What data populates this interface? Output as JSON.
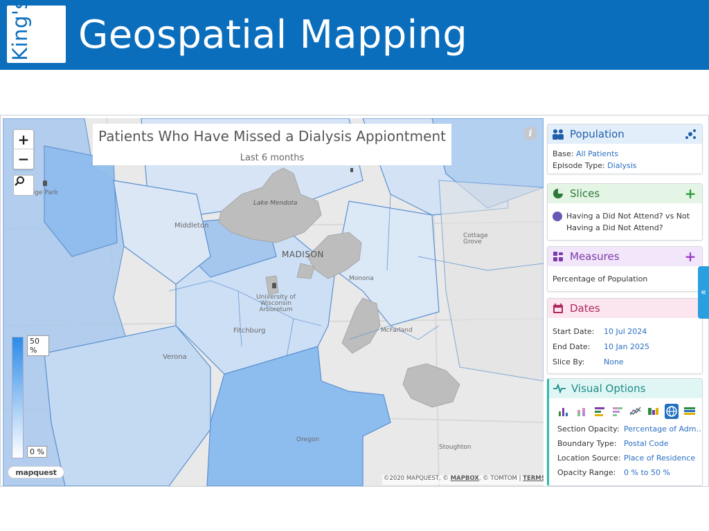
{
  "header": {
    "logo_text": "King's",
    "title": "Geospatial Mapping",
    "background_color": "#0a6ebd"
  },
  "map": {
    "title": "Patients Who Have Missed a Dialysis Appiontment",
    "subtitle": "Last 6 months",
    "zoom_in_label": "+",
    "zoom_out_label": "−",
    "legend": {
      "max_label": "50 %",
      "min_label": "0 %"
    },
    "provider_logo": "mapquest",
    "attribution_prefix": "©2020 MAPQUEST, © ",
    "attribution_mapbox": "MAPBOX",
    "attribution_mid": ", © TOMTOM | ",
    "attribution_terms": "TERMS",
    "places": {
      "prestige_park": "estige Park",
      "lake_mendota": "Lake Mendota",
      "middleton": "Middleton",
      "madison": "MADISON",
      "cottage_grove": "Cottage\nGrove",
      "monona": "Monona",
      "uw_arboretum": "University of\nWisconsin\nArboretum",
      "fitchburg": "Fitchburg",
      "mcfarland": "McFarland",
      "verona": "Verona",
      "oregon": "Oregon",
      "stoughton": "Stoughton"
    },
    "colors": {
      "choropleth_light": "#d9e6f5",
      "choropleth_mid": "#b7d2f0",
      "choropleth_dark": "#8dbcee",
      "lake": "#bdbdbd",
      "boundary": "#5a8fd0"
    }
  },
  "panel": {
    "population": {
      "title": "Population",
      "base_label": "Base:",
      "base_value": "All Patients",
      "episode_label": "Episode Type:",
      "episode_value": "Dialysis"
    },
    "slices": {
      "title": "Slices",
      "add_label": "+",
      "item_line1": "Having a Did Not Attend? vs Not",
      "item_line2": "Having a Did Not Attend?"
    },
    "measures": {
      "title": "Measures",
      "add_label": "+",
      "item": "Percentage of Population"
    },
    "dates": {
      "title": "Dates",
      "start_label": "Start Date:",
      "start_value": "10 Jul 2024",
      "end_label": "End Date:",
      "end_value": "10 Jan 2025",
      "sliceby_label": "Slice By:",
      "sliceby_value": "None"
    },
    "visual_options": {
      "title": "Visual Options",
      "section_opacity_label": "Section Opacity:",
      "section_opacity_value": "Percentage of Adm…",
      "boundary_type_label": "Boundary Type:",
      "boundary_type_value": "Postal Code",
      "location_source_label": "Location Source:",
      "location_source_value": "Place of Residence",
      "opacity_range_label": "Opacity Range:",
      "opacity_range_value": "0 % to 50 %",
      "chart_types": [
        "bar-chart-icon",
        "stacked-bar-icon",
        "horizontal-bar-icon",
        "horizontal-stacked-icon",
        "line-chart-icon",
        "heatmap-icon",
        "map-icon",
        "table-icon"
      ],
      "selected_chart_type": "map-icon"
    },
    "collapse_label": "«"
  }
}
